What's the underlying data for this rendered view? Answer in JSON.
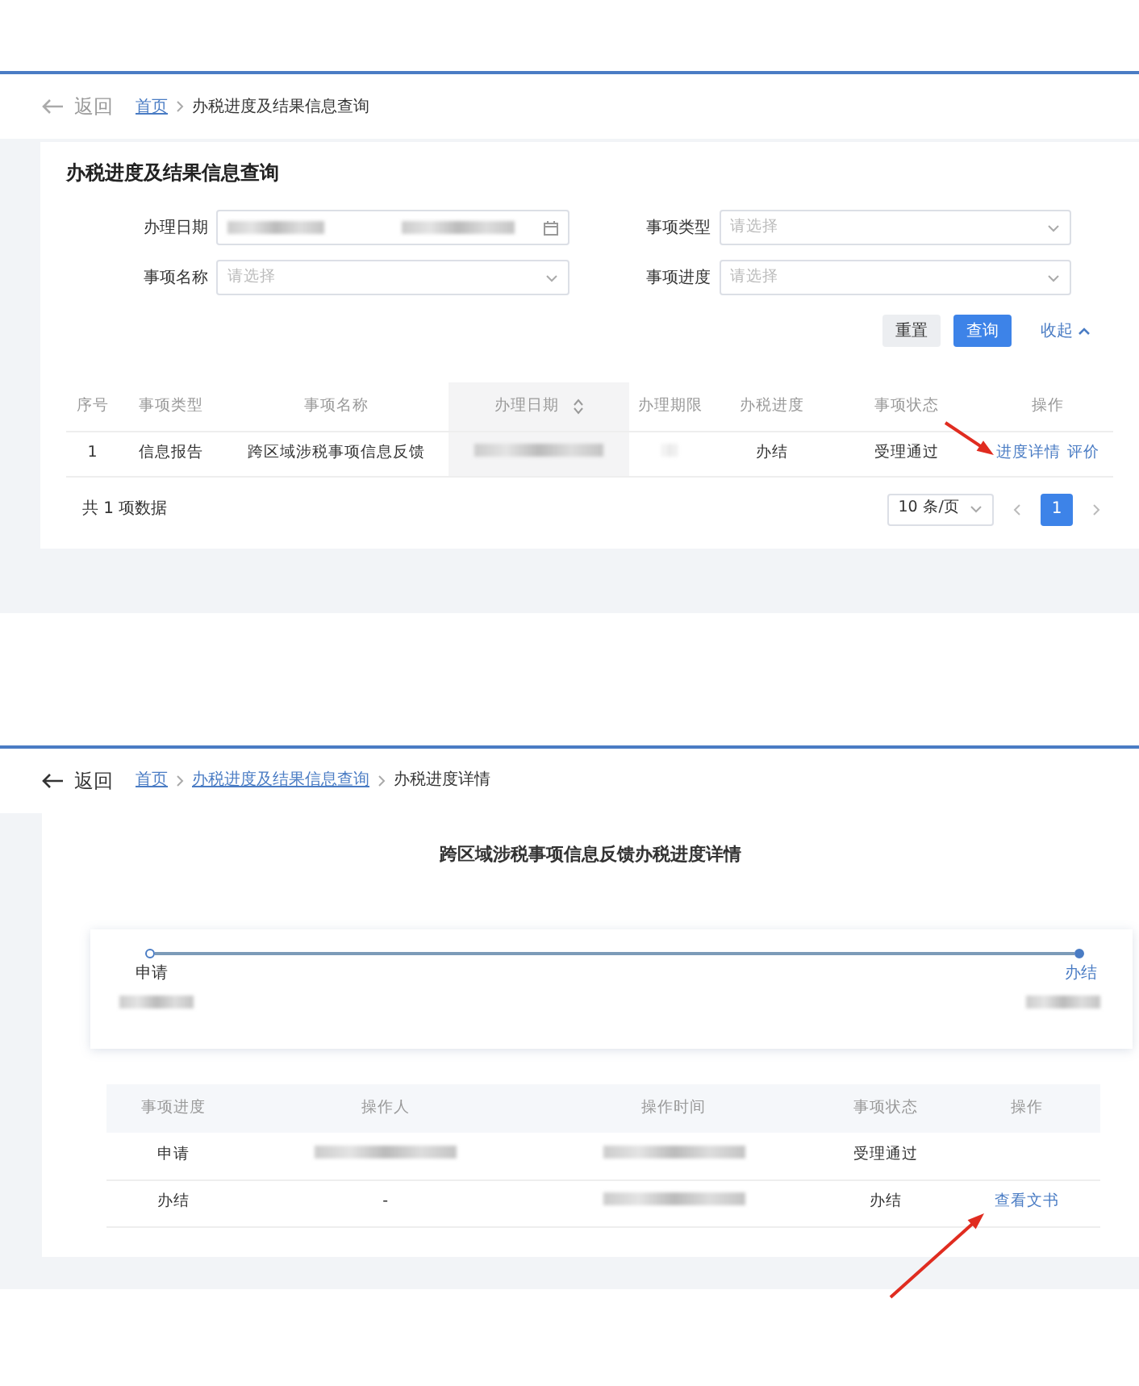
{
  "query_page": {
    "back": "返回",
    "breadcrumb": [
      {
        "label": "首页",
        "link": true
      },
      {
        "label": "办税进度及结果信息查询",
        "link": false
      }
    ],
    "title": "办税进度及结果信息查询",
    "filters": [
      {
        "label": "办理日期",
        "kind": "date"
      },
      {
        "label": "事项类型",
        "kind": "select",
        "placeholder": "请选择"
      },
      {
        "label": "事项名称",
        "kind": "select",
        "placeholder": "请选择"
      },
      {
        "label": "事项进度",
        "kind": "select",
        "placeholder": "请选择"
      }
    ],
    "buttons": [
      {
        "label": "重置",
        "kind": "secondary"
      },
      {
        "label": "查询",
        "kind": "primary"
      }
    ],
    "collapse": "收起",
    "table": {
      "columns": [
        {
          "label": "序号",
          "sortable": false
        },
        {
          "label": "事项类型",
          "sortable": false
        },
        {
          "label": "事项名称",
          "sortable": false
        },
        {
          "label": "办理日期",
          "sortable": true
        },
        {
          "label": "办理期限",
          "sortable": false
        },
        {
          "label": "办税进度",
          "sortable": false
        },
        {
          "label": "事项状态",
          "sortable": false
        },
        {
          "label": "操作",
          "sortable": false
        }
      ],
      "rows": [
        {
          "cells": [
            {
              "kind": "text",
              "text": "1"
            },
            {
              "kind": "text",
              "text": "信息报告"
            },
            {
              "kind": "text",
              "text": "跨区域涉税事项信息反馈"
            },
            {
              "kind": "blurred"
            },
            {
              "kind": "faint"
            },
            {
              "kind": "text",
              "text": "办结"
            },
            {
              "kind": "text",
              "text": "受理通过"
            },
            {
              "kind": "links",
              "links": [
                "进度详情",
                "评价"
              ]
            }
          ]
        }
      ]
    },
    "total": "共 1 项数据",
    "page_size": "10 条/页",
    "pages": [
      {
        "label": "1",
        "selected": true
      }
    ]
  },
  "detail_page": {
    "back": "返回",
    "breadcrumb": [
      {
        "label": "首页",
        "link": true
      },
      {
        "label": "办税进度及结果信息查询",
        "link": true
      },
      {
        "label": "办税进度详情",
        "link": false
      }
    ],
    "title": "跨区域涉税事项信息反馈办税进度详情",
    "steps": [
      {
        "label": "申请",
        "current": false
      },
      {
        "label": "办结",
        "current": true
      }
    ],
    "table": {
      "columns": [
        "事项进度",
        "操作人",
        "操作时间",
        "事项状态",
        "操作"
      ],
      "rows": [
        {
          "cells": [
            {
              "kind": "text",
              "text": "申请"
            },
            {
              "kind": "blurred"
            },
            {
              "kind": "blurred"
            },
            {
              "kind": "text",
              "text": "受理通过"
            },
            {
              "kind": "empty"
            }
          ]
        },
        {
          "cells": [
            {
              "kind": "text",
              "text": "办结"
            },
            {
              "kind": "text",
              "text": "-"
            },
            {
              "kind": "blurred"
            },
            {
              "kind": "text",
              "text": "办结"
            },
            {
              "kind": "links",
              "links": [
                "查看文书"
              ]
            }
          ]
        }
      ]
    }
  }
}
